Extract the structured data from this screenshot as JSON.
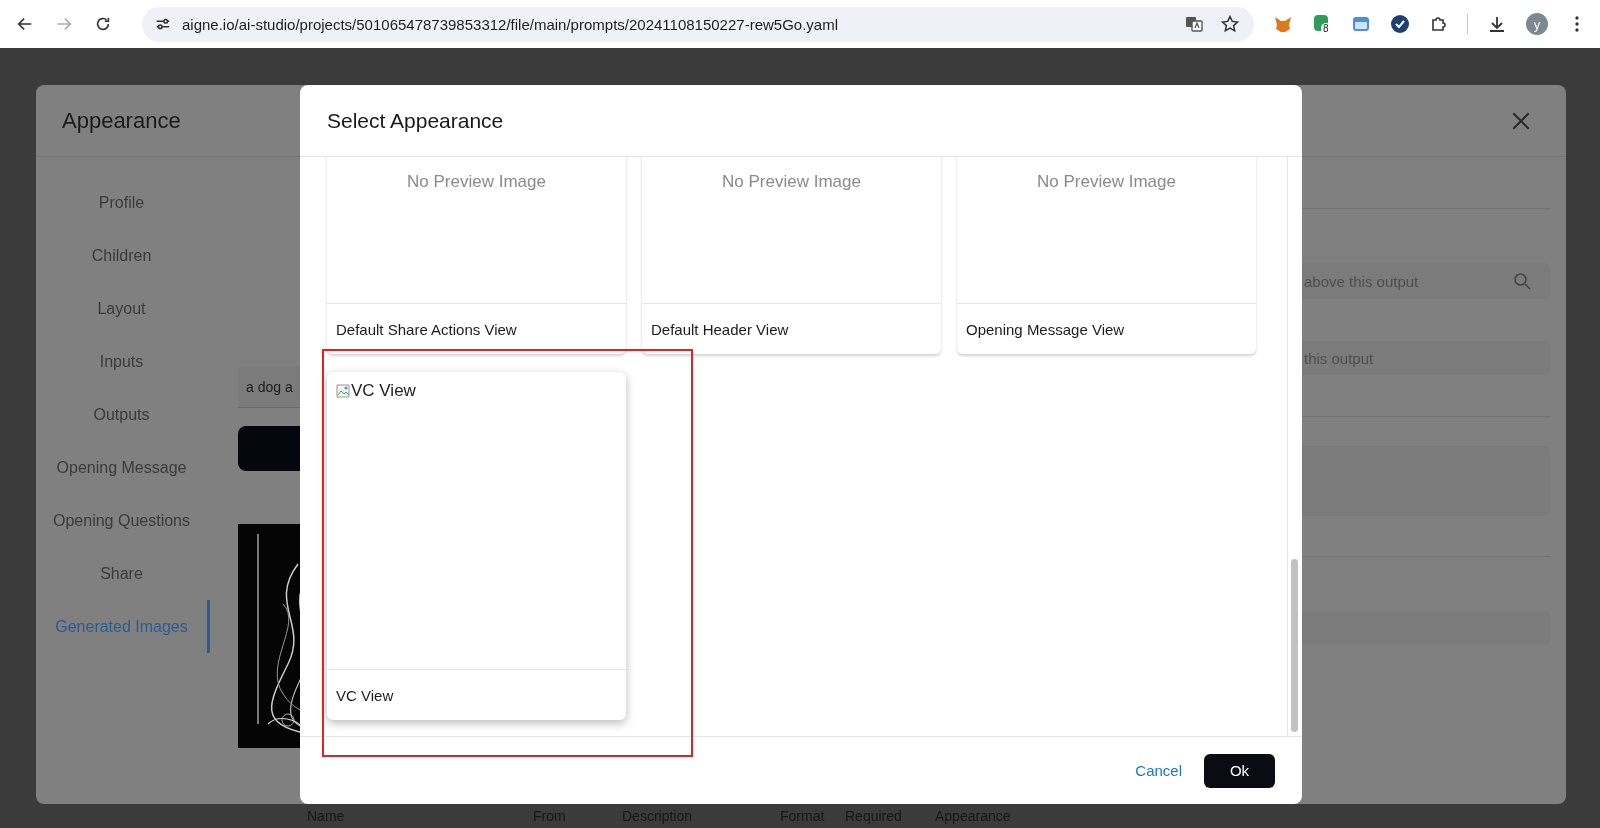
{
  "browser": {
    "url": "aigne.io/ai-studio/projects/501065478739853312/file/main/prompts/20241108150227-rew5Go.yaml",
    "extension_badge": "8",
    "profile_initial": "y"
  },
  "page": {
    "table_headers": [
      "Name",
      "From",
      "Description",
      "Format",
      "Required",
      "Appearance"
    ]
  },
  "appearance_dialog": {
    "title": "Appearance",
    "nav": [
      {
        "label": "Profile",
        "selected": false
      },
      {
        "label": "Children",
        "selected": false
      },
      {
        "label": "Layout",
        "selected": false
      },
      {
        "label": "Inputs",
        "selected": false
      },
      {
        "label": "Outputs",
        "selected": false
      },
      {
        "label": "Opening Message",
        "selected": false
      },
      {
        "label": "Opening Questions",
        "selected": false
      },
      {
        "label": "Share",
        "selected": false
      },
      {
        "label": "Generated Images",
        "selected": true
      }
    ],
    "prompt_input": {
      "value": "a dog a"
    },
    "fields": [
      {
        "placeholder": "above this output",
        "kind": "search"
      },
      {
        "placeholder": "this output",
        "kind": "plain"
      }
    ]
  },
  "select_dialog": {
    "title": "Select Appearance",
    "cards": [
      {
        "label": "Default Share Actions View",
        "preview": "No Preview Image",
        "kind": "placeholder",
        "highlighted": false
      },
      {
        "label": "Default Header View",
        "preview": "No Preview Image",
        "kind": "placeholder",
        "highlighted": false
      },
      {
        "label": "Opening Message View",
        "preview": "No Preview Image",
        "kind": "placeholder",
        "highlighted": false
      },
      {
        "label": "VC View",
        "preview": "VC View",
        "kind": "broken-image",
        "highlighted": true
      }
    ],
    "buttons": {
      "cancel": "Cancel",
      "ok": "Ok"
    }
  }
}
